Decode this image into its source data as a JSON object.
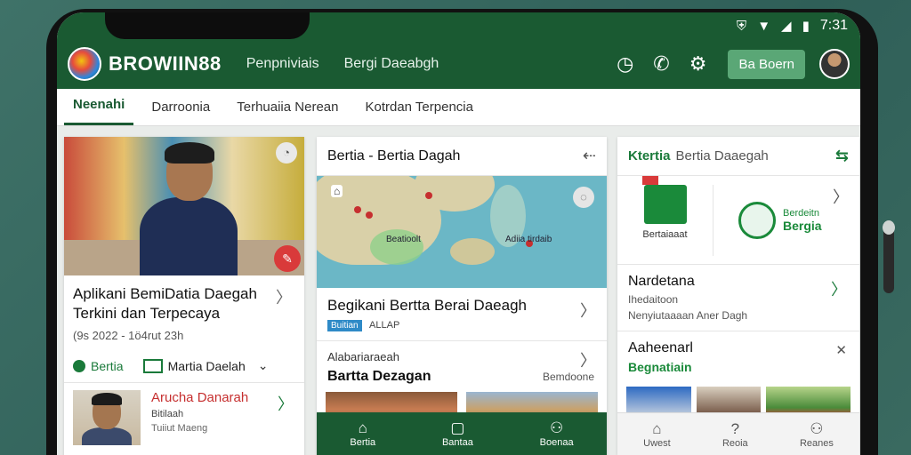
{
  "status_bar": {
    "time": "7:31"
  },
  "app_bar": {
    "brand": "BROWIIN88",
    "nav": [
      "Penpniviais",
      "Bergi Daeabgh"
    ],
    "action_button": "Ba Boern"
  },
  "tabs": [
    "Neenahi",
    "Darroonia",
    "Terhuaiia Nerean",
    "Kotrdan Terpencia"
  ],
  "col1": {
    "title_line1": "Aplikani BemiDatia Daegah",
    "title_line2": "Terkini dan Terpecaya",
    "date": "(9s 2022 - 1ö4rut 23h",
    "action1": "Bertia",
    "action2": "Martia Daelah",
    "mini_title": "Arucha Danarah",
    "mini_sub": "Bitilaah",
    "mini_sub2": "Tuiiut Maeng"
  },
  "col2": {
    "header": "Bertia - Bertia Dagah",
    "map_label1": "Beatioolt",
    "map_label2": "Adiia tirdaib",
    "title": "Begikani Bertta  Berai Daeagh",
    "tag1": "Buitian",
    "tag2": "ALLAP",
    "small": "Alabariaraeah",
    "bold": "Bartta Dezagan",
    "right": "Bemdoone",
    "nav": [
      "Bertia",
      "Bantaa",
      "Boenaa"
    ]
  },
  "col3": {
    "header": "Ktertia",
    "header_sub": "Bertia Daaegah",
    "logo1_label": "Bertaiaaat",
    "logo2_title": "Berdeitn",
    "logo2_sub": "Bergia",
    "block1_title": "Nardetana",
    "block1_s1": "Ihedaitoon",
    "block1_s2": "Nenyiutaaaan Aner Dagh",
    "block2_title": "Aaheenarl",
    "block2_green": "Begnatiain",
    "nav": [
      "Uwest",
      "Reoia",
      "Reanes"
    ]
  }
}
